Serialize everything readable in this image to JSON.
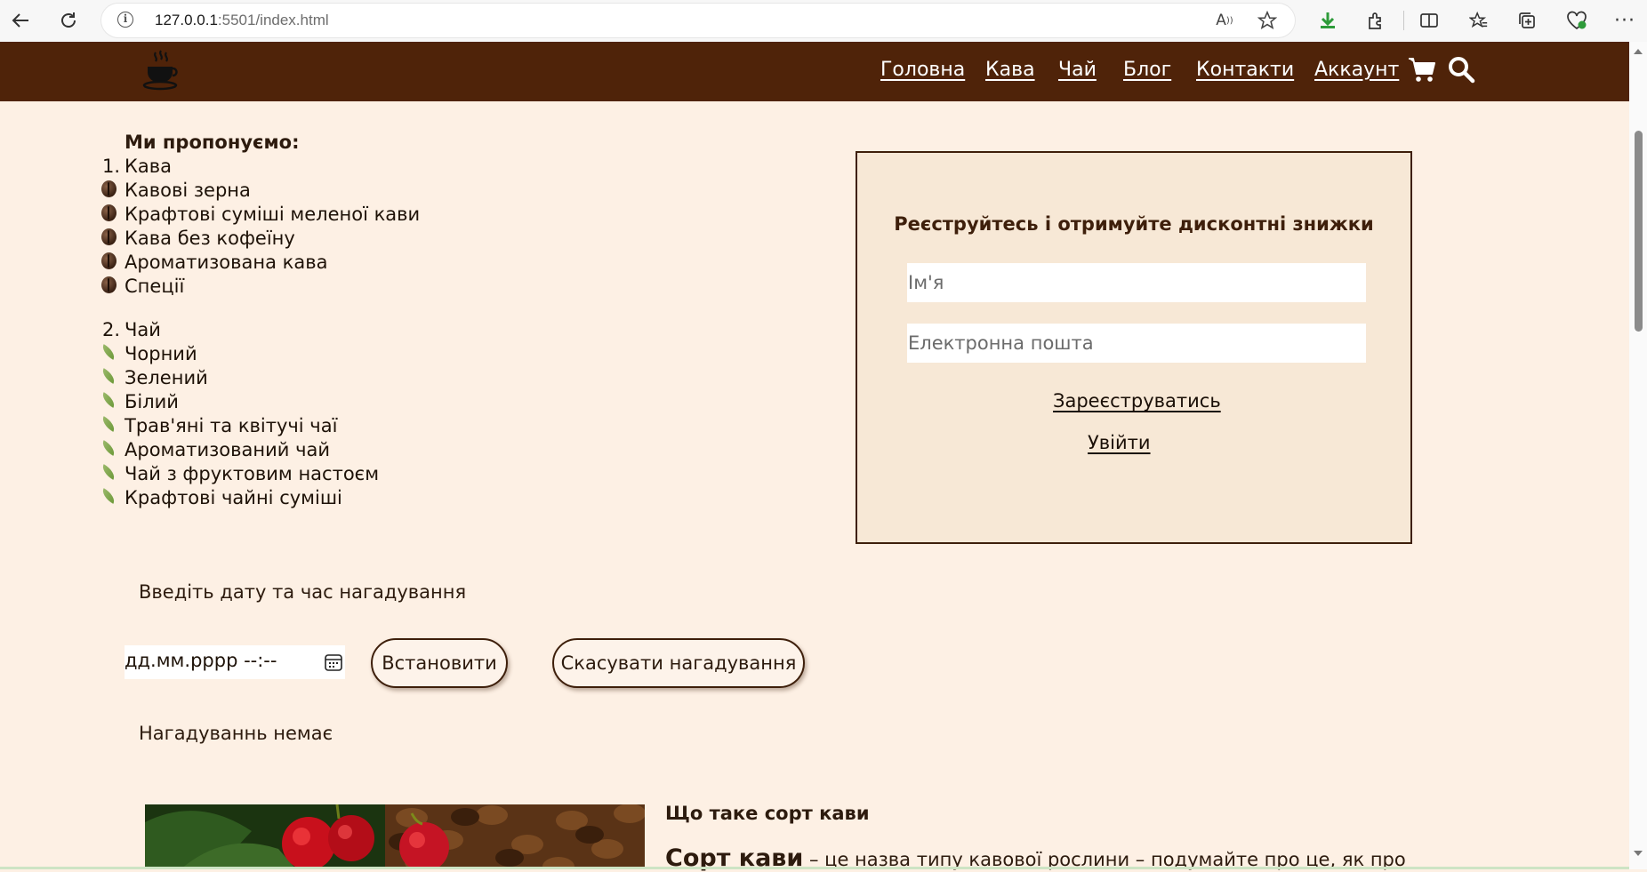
{
  "browser": {
    "url_host": "127.0.0.1",
    "url_rest": ":5501/index.html"
  },
  "nav": {
    "items": [
      "Головна",
      "Кава",
      "Чай",
      "Блог",
      "Контакти",
      "Аккаунт"
    ]
  },
  "offers": {
    "title": "Ми пропонуємо:",
    "coffee_num": "1.",
    "coffee_label": "Кава",
    "coffee_items": [
      "Кавові зерна",
      "Крафтові суміші меленої кави",
      "Кава без кофеїну",
      "Ароматизована кава",
      "Спеції"
    ],
    "tea_num": "2.",
    "tea_label": "Чай",
    "tea_items": [
      "Чорний",
      "Зелений",
      "Білий",
      "Трав'яні та квітучі чаї",
      "Ароматизований чай",
      "Чай з фруктовим настоєм",
      "Крафтові чайні суміші"
    ]
  },
  "register": {
    "title": "Реєструйтесь і отримуйте дисконтні знижки",
    "name_placeholder": "Ім'я",
    "email_placeholder": "Електронна пошта",
    "register_link": "Зареєструватись",
    "login_link": "Увійти"
  },
  "reminder": {
    "prompt": "Введіть дату та час нагадування",
    "datetime_placeholder": "дд.мм.рррр --:--",
    "set_button": "Встановити",
    "cancel_button": "Скасувати нагадування",
    "status": "Нагадуваннь немає"
  },
  "coffee_section": {
    "heading": "Що таке сорт кави",
    "text_bold": "Сорт кави",
    "text_rest": " – це назва типу кавової рослини – подумайте про це, як про"
  },
  "colors": {
    "header_bg": "#4f2309",
    "page_bg": "#fdf0e4",
    "box_bg": "#f7e8d6",
    "accent": "#3e1f0b"
  }
}
